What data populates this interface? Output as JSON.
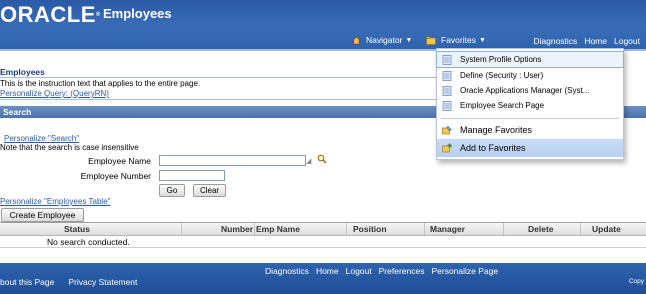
{
  "header": {
    "brand": "ORACLE",
    "app_title": "Employees",
    "navigator_label": "Navigator",
    "favorites_label": "Favorites",
    "global_links": [
      "Diagnostics",
      "Home",
      "Logout"
    ]
  },
  "page": {
    "title": "Employees",
    "instruction": "This is the instruction text that applies to the entire page.",
    "personalize_query": "Personalize Query: (QueryRN)"
  },
  "search": {
    "header": "Search",
    "personalize_link": "Personalize \"Search\"",
    "note": "Note that the search is case insensitive",
    "employee_name_label": "Employee Name",
    "employee_number_label": "Employee Number",
    "go_label": "Go",
    "clear_label": "Clear"
  },
  "results": {
    "personalize_link": "Personalize \"Employees Table\"",
    "create_label": "Create Employee",
    "columns": [
      "Status",
      "Number",
      "Emp Name",
      "Position",
      "Manager",
      "Delete",
      "Update"
    ],
    "empty_text": "No search conducted."
  },
  "footer": {
    "links": [
      "Diagnostics",
      "Home",
      "Logout",
      "Preferences",
      "Personalize Page"
    ],
    "left_links": [
      "bout this Page",
      "Privacy Statement"
    ],
    "copyright": "Copy"
  },
  "favorites_menu": {
    "items": [
      "System Profile Options",
      "Define (Security : User)",
      "Oracle Applications Manager (Syst...",
      "Employee Search Page"
    ],
    "manage_label": "Manage Favorites",
    "add_label": "Add to Favorites"
  },
  "colors": {
    "header_blue": "#2f63ae",
    "link_blue": "#2a5aa6",
    "menu_highlight": "#c9dcf5"
  }
}
